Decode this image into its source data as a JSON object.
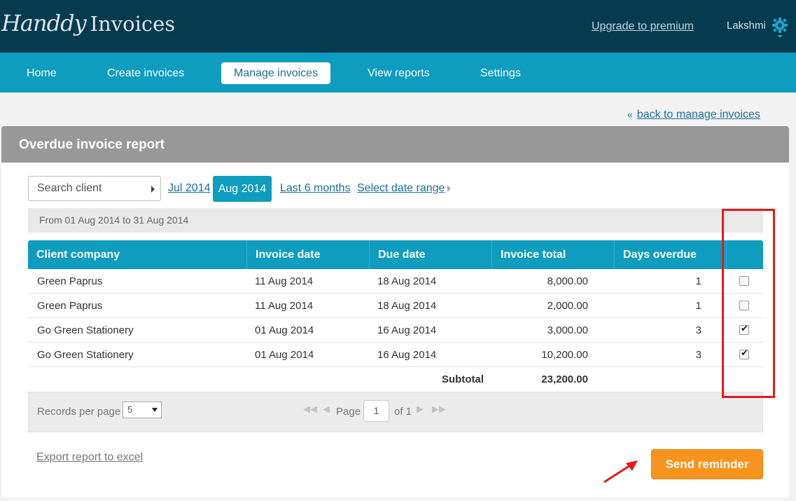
{
  "brand": {
    "logo_script": "Handdy",
    "logo_text": "Invoices"
  },
  "header": {
    "upgrade_link": "Upgrade to premium",
    "username": "Lakshmi"
  },
  "nav": {
    "home": "Home",
    "create": "Create invoices",
    "manage": "Manage invoices",
    "reports": "View reports",
    "settings": "Settings"
  },
  "back_link": {
    "icon": "«",
    "label": "back to manage invoices"
  },
  "report": {
    "title": "Overdue invoice report",
    "search_placeholder": "Search client",
    "filters": {
      "jul": "Jul 2014",
      "aug": "Aug 2014",
      "last6": "Last 6 months",
      "range": "Select date range"
    },
    "date_range_text": "From 01 Aug 2014 to 31 Aug 2014",
    "columns": [
      "Client company",
      "Invoice date",
      "Due date",
      "Invoice total",
      "Days overdue"
    ],
    "rows": [
      {
        "client": "Green Paprus",
        "invoice_date": "11 Aug 2014",
        "due_date": "18 Aug 2014",
        "total": "8,000.00",
        "days": "1",
        "checked": false
      },
      {
        "client": "Green Paprus",
        "invoice_date": "11 Aug 2014",
        "due_date": "18 Aug 2014",
        "total": "2,000.00",
        "days": "1",
        "checked": false
      },
      {
        "client": "Go Green Stationery",
        "invoice_date": "01 Aug 2014",
        "due_date": "16 Aug 2014",
        "total": "3,000.00",
        "days": "3",
        "checked": true
      },
      {
        "client": "Go Green Stationery",
        "invoice_date": "01 Aug 2014",
        "due_date": "16 Aug 2014",
        "total": "10,200.00",
        "days": "3",
        "checked": true
      }
    ],
    "subtotal_label": "Subtotal",
    "subtotal_value": "23,200.00"
  },
  "pager": {
    "records_label": "Records per page",
    "per_page": "5",
    "page_label": "Page",
    "page": "1",
    "of_label": "of 1"
  },
  "actions": {
    "export": "Export report to excel",
    "send_reminder": "Send reminder"
  },
  "colors": {
    "topbar": "#063a4e",
    "nav": "#0e9cbf",
    "accent_orange": "#f7941d",
    "highlight_red": "#e21b1b"
  }
}
